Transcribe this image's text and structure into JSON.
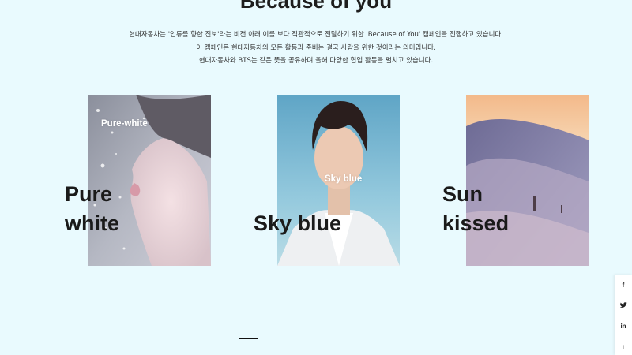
{
  "header": {
    "title": "Because of you"
  },
  "intro": {
    "lines": [
      "현대자동차는 '인류를 향한 진보'라는 비전 아래 이를 보다 직관적으로 전달하기 위한 'Because of You' 캠페인을 진행하고 있습니다.",
      "이 캠페인은 현대자동차의 모든 활동과 준비는 결국 사람을 위한 것이라는 의미입니다.",
      "현대자동차와 BTS는 같은 뜻을 공유하며 올해 다양한 협업 활동을 펼치고 있습니다."
    ]
  },
  "cards": [
    {
      "tag": "Pure-white",
      "title_line1": "Pure",
      "title_line2": "white"
    },
    {
      "tag": "Sky blue",
      "title_line1": "",
      "title_line2": "Sky blue"
    },
    {
      "title_line1": "Sun",
      "title_line2": "kissed"
    }
  ],
  "carousel": {
    "slide_count": 7,
    "active_index": 1
  },
  "share": {
    "facebook": "f",
    "twitter": "t",
    "linkedin": "in",
    "top": "↑"
  },
  "colors": {
    "background": "#e9fafe",
    "accent": "#111111"
  }
}
